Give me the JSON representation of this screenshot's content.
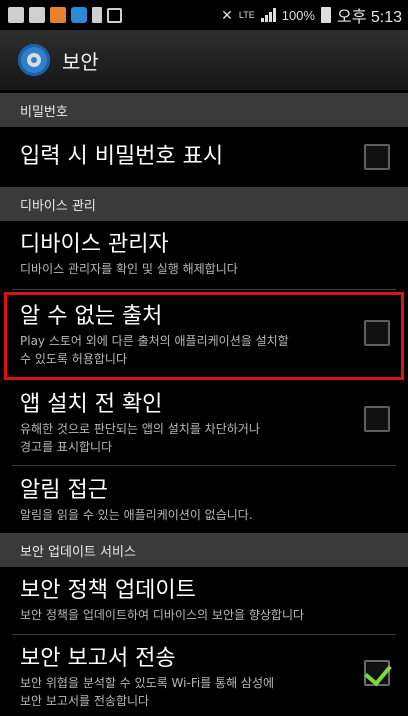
{
  "status_bar": {
    "lte": "LTE",
    "battery_percent": "100%",
    "time": "오후 5:13",
    "icons": [
      "app-icon",
      "gallery-icon",
      "orange-app-icon",
      "blue-app-icon",
      "battery-status-icon",
      "usb-icon",
      "mute-icon",
      "signal-icon",
      "battery-icon"
    ]
  },
  "header": {
    "title": "보안",
    "icon": "gear-icon"
  },
  "sections": {
    "password": "비밀번호",
    "device_admin": "디바이스 관리",
    "security_update": "보안 업데이트 서비스"
  },
  "items": {
    "show_password": {
      "title": "입력 시 비밀번호 표시",
      "checked": false
    },
    "device_administrators": {
      "title": "디바이스 관리자",
      "subtitle": "디바이스 관리자를 확인 및 실행 해제합니다"
    },
    "unknown_sources": {
      "title": "알 수 없는 출처",
      "subtitle_line1": "Play 스토어 외에 다른 출처의 애플리케이션을 설치할",
      "subtitle_line2": "수 있도록 허용합니다",
      "checked": false
    },
    "verify_apps": {
      "title": "앱 설치 전 확인",
      "subtitle_line1": "유해한 것으로 판단되는 앱의 설치를 차단하거나",
      "subtitle_line2": "경고를 표시합니다",
      "checked": false
    },
    "notification_access": {
      "title": "알림 접근",
      "subtitle": "알림을 읽을 수 있는 애플리케이션이 없습니다."
    },
    "security_policy_update": {
      "title": "보안 정책 업데이트",
      "subtitle": "보안 정책을 업데이트하여 디바이스의 보안을 향상합니다"
    },
    "send_security_reports": {
      "title": "보안 보고서 전송",
      "subtitle_line1": "보안 위협을 분석할 수 있도록 Wi-Fi를 통해 삼성에",
      "subtitle_line2": "보안 보고서를 전송합니다",
      "checked": true
    }
  },
  "colors": {
    "highlight": "#e01010",
    "check": "#7ed640",
    "section_bg": "#3a3a3a",
    "accent_gear": "#2f7fd0"
  }
}
